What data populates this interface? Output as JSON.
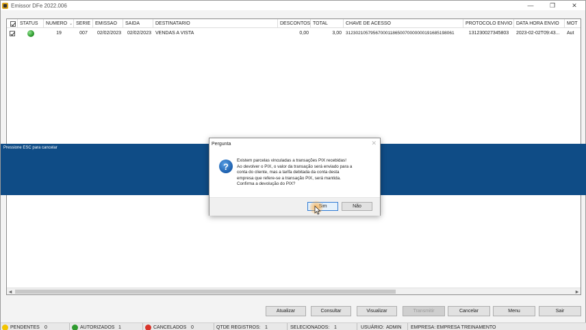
{
  "window": {
    "title": "Emissor DFe 2022.006",
    "minimize_glyph": "—",
    "restore_glyph": "❐",
    "close_glyph": "✕"
  },
  "grid": {
    "columns": [
      {
        "key": "check",
        "label": ""
      },
      {
        "key": "status",
        "label": "STATUS"
      },
      {
        "key": "numero",
        "label": "NUMERO"
      },
      {
        "key": "serie",
        "label": "SERIE"
      },
      {
        "key": "emissao",
        "label": "EMISSAO"
      },
      {
        "key": "saida",
        "label": "SAIDA"
      },
      {
        "key": "destinatario",
        "label": "DESTINATARIO"
      },
      {
        "key": "descontos",
        "label": "DESCONTOS"
      },
      {
        "key": "total",
        "label": "TOTAL"
      },
      {
        "key": "chave",
        "label": "CHAVE DE ACESSO"
      },
      {
        "key": "protocolo",
        "label": "PROTOCOLO ENVIO"
      },
      {
        "key": "data_hora",
        "label": "DATA HORA ENVIO"
      },
      {
        "key": "mot",
        "label": "MOT"
      }
    ],
    "rows": [
      {
        "checked": true,
        "status_color": "#2e9a2e",
        "numero": "19",
        "serie": "007",
        "emissao": "02/02/2023",
        "saida": "02/02/2023",
        "destinatario": "VENDAS A VISTA",
        "descontos": "0,00",
        "total": "3,00",
        "chave": "31230210579567000118650070000000191685198061",
        "protocolo": "131230027345803",
        "data_hora": "2023-02-02T09:43...",
        "mot": "Aut"
      }
    ],
    "sort_glyph": "⌄"
  },
  "overlay": {
    "band_text": "Pressione ESC para cancelar",
    "band_color": "#0f4c86"
  },
  "dialog": {
    "title": "Pergunta",
    "close_glyph": "✕",
    "icon": "question-icon",
    "message_lines": [
      "Existem parcelas vinculadas a transações PIX recebidas!",
      "Ao devolver o PIX, o valor da transação será enviado para a",
      "conta do cliente, mas a tarifa debitada da conta desta",
      "empresa que refere-se a transação PIX, será mantida.",
      "Confirma a devolução do PIX?"
    ],
    "yes_label": "Sim",
    "no_label": "Não"
  },
  "toolbar": {
    "atualizar": "Atualizar",
    "consultar": "Consultar",
    "visualizar": "Visualizar",
    "transmitir": "Transmitir",
    "cancelar": "Cancelar",
    "menu": "Menu",
    "sair": "Sair"
  },
  "statusbar": {
    "pendentes_label": "PENDENTES",
    "pendentes_count": "0",
    "pendentes_color": "#f2c400",
    "autorizados_label": "AUTORIZADOS",
    "autorizados_count": "1",
    "autorizados_color": "#2e9a2e",
    "cancelados_label": "CANCELADOS",
    "cancelados_count": "0",
    "cancelados_color": "#d9352b",
    "qtde_label": "QTDE REGISTROS:",
    "qtde_value": "1",
    "selecionados_label": "SELECIONADOS:",
    "selecionados_value": "1",
    "usuario_label": "USUÁRIO:",
    "usuario_value": "ADMIN",
    "empresa_label": "EMPRESA:",
    "empresa_value": "EMPRESA TREINAMENTO"
  }
}
